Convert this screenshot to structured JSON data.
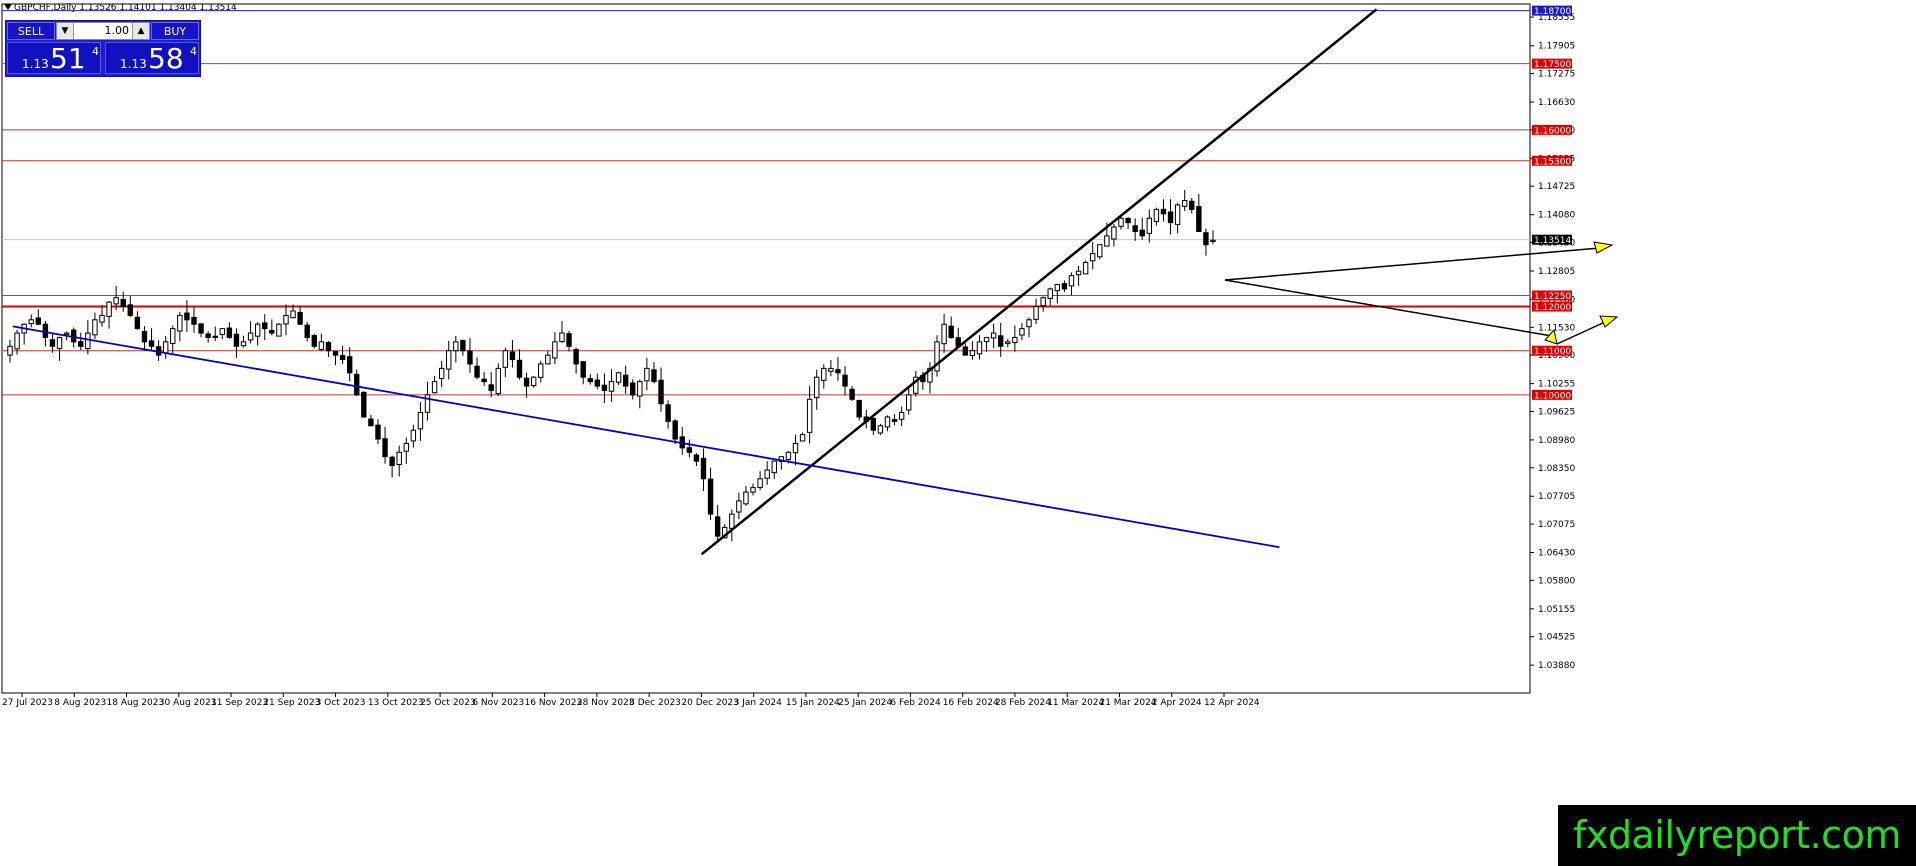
{
  "header": {
    "title": "GBPCHF,Daily  1.13526 1.14101 1.13404 1.13514"
  },
  "trade_panel": {
    "sell_label": "SELL",
    "buy_label": "BUY",
    "lot_value": "1.00",
    "sell_price_small": "1.13",
    "sell_price_big": "51",
    "sell_price_sup": "4",
    "buy_price_small": "1.13",
    "buy_price_big": "58",
    "buy_price_sup": "4"
  },
  "watermark": "fxdailyreport.com",
  "colors": {
    "background": "#ffffff",
    "level_line": "#c0392b",
    "level_label_bg": "#e00000",
    "trendline_up": "#000000",
    "trendline_down": "#0000c8",
    "arrow_fill": "#ffff00",
    "watermark_text": "#22dd22"
  },
  "chart_data": {
    "type": "candlestick",
    "symbol": "GBPCHF",
    "timeframe": "Daily",
    "ohlc": [
      1.13526,
      1.14101,
      1.13404,
      1.13514
    ],
    "ylim": [
      1.0325,
      1.1885
    ],
    "y_ticks": [
      "1.18555",
      "1.17905",
      "1.17275",
      "1.16630",
      "1.16000",
      "1.15355",
      "1.14725",
      "1.14080",
      "1.13450",
      "1.12805",
      "1.12160",
      "1.11530",
      "1.10900",
      "1.10255",
      "1.09625",
      "1.08980",
      "1.08350",
      "1.07705",
      "1.07075",
      "1.06430",
      "1.05800",
      "1.05155",
      "1.04525",
      "1.03880"
    ],
    "x_ticks": [
      "27 Jul 2023",
      "8 Aug 2023",
      "18 Aug 2023",
      "30 Aug 2023",
      "11 Sep 2023",
      "21 Sep 2023",
      "3 Oct 2023",
      "13 Oct 2023",
      "25 Oct 2023",
      "6 Nov 2023",
      "16 Nov 2023",
      "28 Nov 2023",
      "8 Dec 2023",
      "20 Dec 2023",
      "3 Jan 2024",
      "15 Jan 2024",
      "25 Jan 2024",
      "6 Feb 2024",
      "16 Feb 2024",
      "28 Feb 2024",
      "11 Mar 2024",
      "21 Mar 2024",
      "2 Apr 2024",
      "12 Apr 2024"
    ],
    "current_price": "1.13514",
    "top_label": "1.18700",
    "levels": [
      {
        "value": 1.175,
        "label": "1.17500"
      },
      {
        "value": 1.16,
        "label": "1.16000"
      },
      {
        "value": 1.153,
        "label": "1.15300"
      },
      {
        "value": 1.1225,
        "label": "1.12250"
      },
      {
        "value": 1.12,
        "label": "1.12000"
      },
      {
        "value": 1.11,
        "label": "1.11000"
      },
      {
        "value": 1.1,
        "label": "1.10000"
      }
    ],
    "trendlines": [
      {
        "name": "uptrend",
        "points": [
          [
            1.0639,
            "2023-12-21"
          ],
          [
            1.1873,
            "2024-05-15"
          ]
        ]
      },
      {
        "name": "downtrend",
        "points": [
          [
            1.1155,
            "2023-07-25"
          ],
          [
            1.0655,
            "2024-04-24"
          ]
        ]
      }
    ],
    "closes": [
      1.111,
      1.114,
      1.116,
      1.117,
      1.116,
      1.113,
      1.111,
      1.113,
      1.114,
      1.112,
      1.111,
      1.114,
      1.117,
      1.118,
      1.121,
      1.122,
      1.12,
      1.118,
      1.115,
      1.112,
      1.111,
      1.109,
      1.112,
      1.115,
      1.118,
      1.117,
      1.116,
      1.114,
      1.113,
      1.113,
      1.115,
      1.113,
      1.111,
      1.112,
      1.114,
      1.116,
      1.115,
      1.114,
      1.116,
      1.118,
      1.119,
      1.116,
      1.113,
      1.111,
      1.112,
      1.11,
      1.109,
      1.108,
      1.105,
      1.1,
      1.095,
      1.093,
      1.09,
      1.086,
      1.084,
      1.087,
      1.089,
      1.092,
      1.096,
      1.1,
      1.103,
      1.106,
      1.11,
      1.112,
      1.11,
      1.107,
      1.104,
      1.103,
      1.101,
      1.106,
      1.11,
      1.108,
      1.104,
      1.102,
      1.104,
      1.107,
      1.109,
      1.112,
      1.114,
      1.111,
      1.107,
      1.104,
      1.103,
      1.102,
      1.101,
      1.103,
      1.105,
      1.102,
      1.1,
      1.103,
      1.106,
      1.103,
      1.098,
      1.094,
      1.09,
      1.088,
      1.087,
      1.085,
      1.081,
      1.073,
      1.068,
      1.07,
      1.073,
      1.076,
      1.078,
      1.079,
      1.081,
      1.083,
      1.085,
      1.086,
      1.087,
      1.089,
      1.091,
      1.099,
      1.104,
      1.106,
      1.106,
      1.105,
      1.102,
      1.099,
      1.095,
      1.094,
      1.092,
      1.093,
      1.095,
      1.094,
      1.096,
      1.1,
      1.104,
      1.103,
      1.106,
      1.112,
      1.116,
      1.113,
      1.111,
      1.109,
      1.11,
      1.112,
      1.113,
      1.114,
      1.111,
      1.112,
      1.113,
      1.115,
      1.117,
      1.12,
      1.122,
      1.124,
      1.125,
      1.124,
      1.127,
      1.128,
      1.13,
      1.132,
      1.134,
      1.136,
      1.138,
      1.14,
      1.139,
      1.137,
      1.136,
      1.14,
      1.142,
      1.141,
      1.139,
      1.143,
      1.144,
      1.142,
      1.137,
      1.134,
      1.135
    ]
  }
}
